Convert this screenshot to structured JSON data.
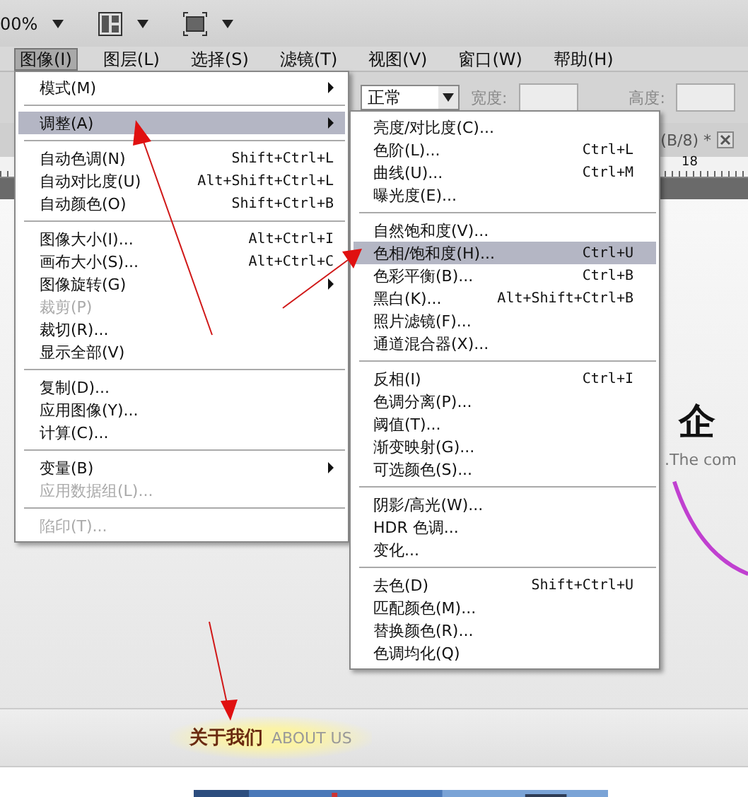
{
  "toolbar": {
    "zoom": "00%"
  },
  "menubar": [
    {
      "label": "图像(I)",
      "selected": true
    },
    {
      "label": "图层(L)",
      "selected": false
    },
    {
      "label": "选择(S)",
      "selected": false
    },
    {
      "label": "滤镜(T)",
      "selected": false
    },
    {
      "label": "视图(V)",
      "selected": false
    },
    {
      "label": "窗口(W)",
      "selected": false
    },
    {
      "label": "帮助(H)",
      "selected": false
    }
  ],
  "options_bar": {
    "mode": "正常",
    "width_label": "宽度:",
    "height_label": "高度:"
  },
  "document": {
    "tab": "(B/8) *",
    "ruler_mark": "18",
    "logo": "企",
    "tagline": ".The com"
  },
  "image_menu": [
    {
      "kind": "item",
      "label": "模式(M)",
      "submenu": true,
      "selected": false,
      "disabled": false
    },
    {
      "kind": "separator"
    },
    {
      "kind": "item",
      "label": "调整(A)",
      "submenu": true,
      "selected": true,
      "disabled": false
    },
    {
      "kind": "separator"
    },
    {
      "kind": "item",
      "label": "自动色调(N)",
      "shortcut": "Shift+Ctrl+L",
      "selected": false,
      "disabled": false
    },
    {
      "kind": "item",
      "label": "自动对比度(U)",
      "shortcut": "Alt+Shift+Ctrl+L",
      "selected": false,
      "disabled": false
    },
    {
      "kind": "item",
      "label": "自动颜色(O)",
      "shortcut": "Shift+Ctrl+B",
      "selected": false,
      "disabled": false
    },
    {
      "kind": "separator"
    },
    {
      "kind": "item",
      "label": "图像大小(I)...",
      "shortcut": "Alt+Ctrl+I",
      "selected": false,
      "disabled": false
    },
    {
      "kind": "item",
      "label": "画布大小(S)...",
      "shortcut": "Alt+Ctrl+C",
      "selected": false,
      "disabled": false
    },
    {
      "kind": "item",
      "label": "图像旋转(G)",
      "submenu": true,
      "selected": false,
      "disabled": false
    },
    {
      "kind": "item",
      "label": "裁剪(P)",
      "selected": false,
      "disabled": true
    },
    {
      "kind": "item",
      "label": "裁切(R)...",
      "selected": false,
      "disabled": false
    },
    {
      "kind": "item",
      "label": "显示全部(V)",
      "selected": false,
      "disabled": false
    },
    {
      "kind": "separator"
    },
    {
      "kind": "item",
      "label": "复制(D)...",
      "selected": false,
      "disabled": false
    },
    {
      "kind": "item",
      "label": "应用图像(Y)...",
      "selected": false,
      "disabled": false
    },
    {
      "kind": "item",
      "label": "计算(C)...",
      "selected": false,
      "disabled": false
    },
    {
      "kind": "separator"
    },
    {
      "kind": "item",
      "label": "变量(B)",
      "submenu": true,
      "selected": false,
      "disabled": false
    },
    {
      "kind": "item",
      "label": "应用数据组(L)...",
      "selected": false,
      "disabled": true
    },
    {
      "kind": "separator"
    },
    {
      "kind": "item",
      "label": "陷印(T)...",
      "selected": false,
      "disabled": true
    }
  ],
  "adjust_menu": [
    {
      "kind": "item",
      "label": "亮度/对比度(C)...",
      "selected": false
    },
    {
      "kind": "item",
      "label": "色阶(L)...",
      "shortcut": "Ctrl+L",
      "selected": false
    },
    {
      "kind": "item",
      "label": "曲线(U)...",
      "shortcut": "Ctrl+M",
      "selected": false
    },
    {
      "kind": "item",
      "label": "曝光度(E)...",
      "selected": false
    },
    {
      "kind": "separator"
    },
    {
      "kind": "item",
      "label": "自然饱和度(V)...",
      "selected": false
    },
    {
      "kind": "item",
      "label": "色相/饱和度(H)...",
      "shortcut": "Ctrl+U",
      "selected": true
    },
    {
      "kind": "item",
      "label": "色彩平衡(B)...",
      "shortcut": "Ctrl+B",
      "selected": false
    },
    {
      "kind": "item",
      "label": "黑白(K)...",
      "shortcut": "Alt+Shift+Ctrl+B",
      "selected": false
    },
    {
      "kind": "item",
      "label": "照片滤镜(F)...",
      "selected": false
    },
    {
      "kind": "item",
      "label": "通道混合器(X)...",
      "selected": false
    },
    {
      "kind": "separator"
    },
    {
      "kind": "item",
      "label": "反相(I)",
      "shortcut": "Ctrl+I",
      "selected": false
    },
    {
      "kind": "item",
      "label": "色调分离(P)...",
      "selected": false
    },
    {
      "kind": "item",
      "label": "阈值(T)...",
      "selected": false
    },
    {
      "kind": "item",
      "label": "渐变映射(G)...",
      "selected": false
    },
    {
      "kind": "item",
      "label": "可选颜色(S)...",
      "selected": false
    },
    {
      "kind": "separator"
    },
    {
      "kind": "item",
      "label": "阴影/高光(W)...",
      "selected": false
    },
    {
      "kind": "item",
      "label": "HDR 色调...",
      "selected": false
    },
    {
      "kind": "item",
      "label": "变化...",
      "selected": false
    },
    {
      "kind": "separator"
    },
    {
      "kind": "item",
      "label": "去色(D)",
      "shortcut": "Shift+Ctrl+U",
      "selected": false
    },
    {
      "kind": "item",
      "label": "匹配颜色(M)...",
      "selected": false
    },
    {
      "kind": "item",
      "label": "替换颜色(R)...",
      "selected": false
    },
    {
      "kind": "item",
      "label": "色调均化(Q)",
      "selected": false
    }
  ],
  "page_section": {
    "title": "关于我们",
    "subtitle": "ABOUT US"
  }
}
